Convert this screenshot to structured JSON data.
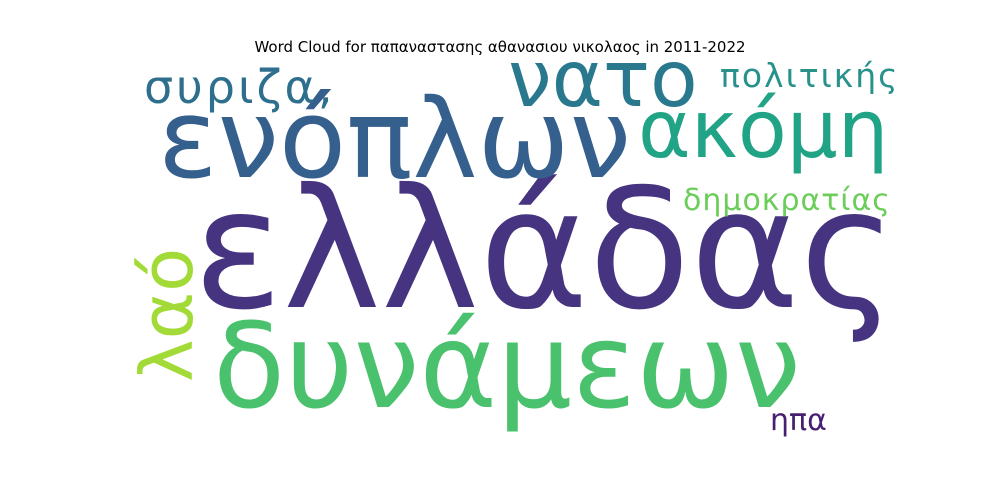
{
  "chart_data": {
    "type": "wordcloud",
    "title": "Word Cloud for παπαναστασης αθανασιου νικολαος in 2011-2022",
    "words": [
      {
        "text": "ελλάδας",
        "weight": 1.0,
        "color": "#463480",
        "rotated": false
      },
      {
        "text": "δυνάμεων",
        "weight": 0.71,
        "color": "#4ac16d",
        "rotated": false
      },
      {
        "text": "ενόπλων",
        "weight": 0.67,
        "color": "#355f8d",
        "rotated": false
      },
      {
        "text": "ακόμη",
        "weight": 0.48,
        "color": "#21a386",
        "rotated": false
      },
      {
        "text": "νατο",
        "weight": 0.47,
        "color": "#2a788e",
        "rotated": false
      },
      {
        "text": "λαό",
        "weight": 0.44,
        "color": "#a2da37",
        "rotated": true
      },
      {
        "text": "συριζα,",
        "weight": 0.27,
        "color": "#2f6f8e",
        "rotated": false
      },
      {
        "text": "πολιτικής",
        "weight": 0.21,
        "color": "#27918b",
        "rotated": false
      },
      {
        "text": "δημοκρατίας",
        "weight": 0.18,
        "color": "#6ccd5a",
        "rotated": false
      },
      {
        "text": "ηπα",
        "weight": 0.18,
        "color": "#481f70",
        "rotated": false
      }
    ]
  }
}
